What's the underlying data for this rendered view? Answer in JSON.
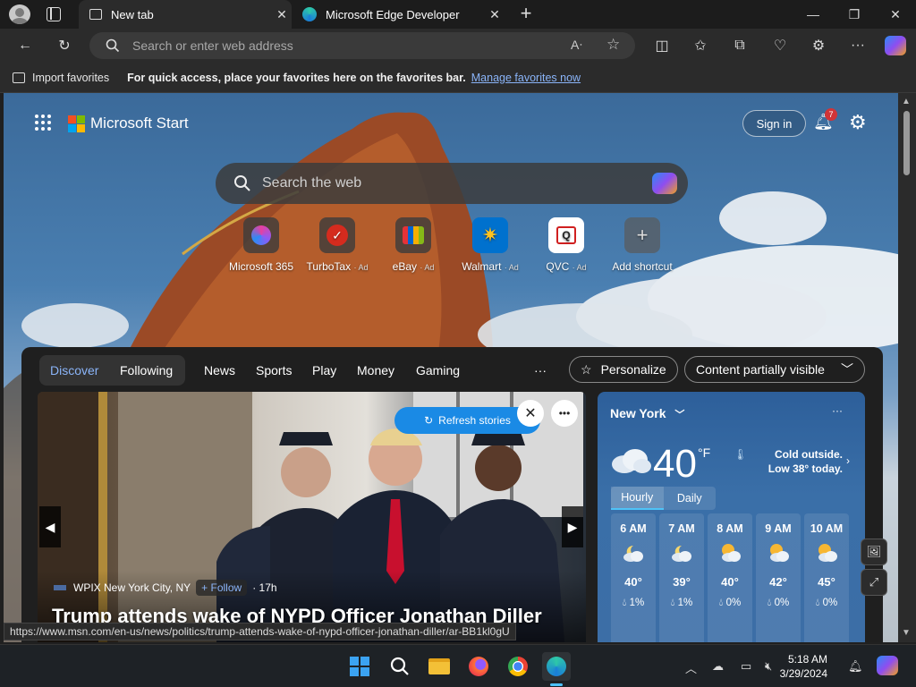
{
  "browser": {
    "tabs": [
      {
        "title": "New tab",
        "active": true
      },
      {
        "title": "Microsoft Edge Developer",
        "active": false
      }
    ],
    "address_placeholder": "Search or enter web address",
    "favorites_bar": {
      "import_label": "Import favorites",
      "message": "For quick access, place your favorites here on the favorites bar.",
      "manage_link": "Manage favorites now"
    },
    "status_url": "https://www.msn.com/en-us/news/politics/trump-attends-wake-of-nypd-officer-jonathan-diller/ar-BB1kl0gU"
  },
  "start": {
    "brand": "Microsoft Start",
    "sign_in": "Sign in",
    "notification_count": "7",
    "search_placeholder": "Search the web",
    "shortcuts": [
      {
        "label": "Microsoft 365",
        "ad": ""
      },
      {
        "label": "TurboTax",
        "ad": "· Ad"
      },
      {
        "label": "eBay",
        "ad": "· Ad"
      },
      {
        "label": "Walmart",
        "ad": "· Ad"
      },
      {
        "label": "QVC",
        "ad": "· Ad"
      },
      {
        "label": "Add shortcut",
        "ad": ""
      }
    ]
  },
  "feed": {
    "tabs": [
      "Discover",
      "Following",
      "News",
      "Sports",
      "Play",
      "Money",
      "Gaming"
    ],
    "more": "···",
    "personalize": "Personalize",
    "visibility": "Content partially visible",
    "refresh": "Refresh stories",
    "story": {
      "source": "WPIX New York City, NY",
      "follow": "+ Follow",
      "age": "· 17h",
      "headline": "Trump attends wake of NYPD Officer Jonathan Diller"
    }
  },
  "weather": {
    "location": "New York",
    "temp": "40",
    "unit": "°F",
    "summary": "Cold outside. Low 38° today.",
    "tabs": [
      "Hourly",
      "Daily"
    ],
    "hours": [
      {
        "time": "6 AM",
        "temp": "40°",
        "precip": "1%",
        "icon": "partly-cloudy-night-icon"
      },
      {
        "time": "7 AM",
        "temp": "39°",
        "precip": "1%",
        "icon": "partly-cloudy-night-icon"
      },
      {
        "time": "8 AM",
        "temp": "40°",
        "precip": "0%",
        "icon": "partly-sunny-icon"
      },
      {
        "time": "9 AM",
        "temp": "42°",
        "precip": "0%",
        "icon": "partly-sunny-icon"
      },
      {
        "time": "10 AM",
        "temp": "45°",
        "precip": "0%",
        "icon": "partly-sunny-icon"
      }
    ]
  },
  "taskbar": {
    "time": "5:18 AM",
    "date": "3/29/2024"
  }
}
